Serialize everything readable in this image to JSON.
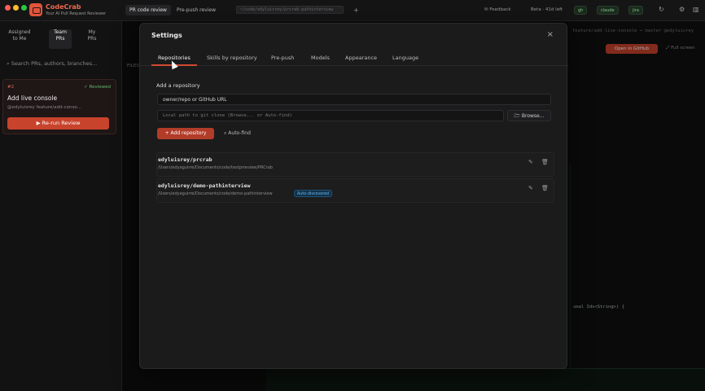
{
  "app": {
    "name": "CodeCrab",
    "tagline": "Your AI Pull Request Reviewer",
    "tabs": [
      "PR code review",
      "Pre-push review"
    ],
    "address": "~/code/edyluisrey/prcrab-pathinterview",
    "feedback": "Feedback",
    "beta": "Beta · 41d left",
    "chips": [
      "gh",
      "claude",
      "jira"
    ]
  },
  "sidebar": {
    "segments": [
      {
        "label": "Assigned to Me"
      },
      {
        "label": "Team PRs"
      },
      {
        "label": "My PRs"
      }
    ],
    "search_placeholder": "Search PRs, authors, branches...",
    "card": {
      "id": "#2",
      "status": "Reviewed",
      "title": "Add live console",
      "meta": "@edyluisrey  feature/add-conso...",
      "rerun": "Re-run Review"
    }
  },
  "background": {
    "crumbs": "feature/add-live-console → master   @edyluisrey",
    "open_github": "Open in GitHub",
    "full_screen": "Full screen",
    "files_label": "FILES",
    "code_snippet": "smal Ids<String>) {"
  },
  "modal": {
    "title": "Settings",
    "tabs": [
      "Repositories",
      "Skills by repository",
      "Pre-push",
      "Models",
      "Appearance",
      "Language"
    ],
    "active_tab": "Repositories",
    "add_label": "Add a repository",
    "repo_input_value": "owner/repo or GitHub URL",
    "path_placeholder": "Local path to git clone (Browse... or Auto-find)",
    "browse": "Browse...",
    "add_button": "+ Add repository",
    "auto_find": "Auto-find",
    "repos": [
      {
        "name": "edyluisrey/prcrab",
        "path": "/Users/edyaguirre/Documents/code/testprreview/PRCrab",
        "badge": ""
      },
      {
        "name": "edyluisrey/demo-pathinterview",
        "path": "/Users/edyaguirre/Documents/code/demo-pathinterview",
        "badge": "Auto-discovered"
      }
    ]
  },
  "colors": {
    "accent": "#d24a33",
    "success": "#62b86d",
    "info": "#6cb7ea"
  }
}
